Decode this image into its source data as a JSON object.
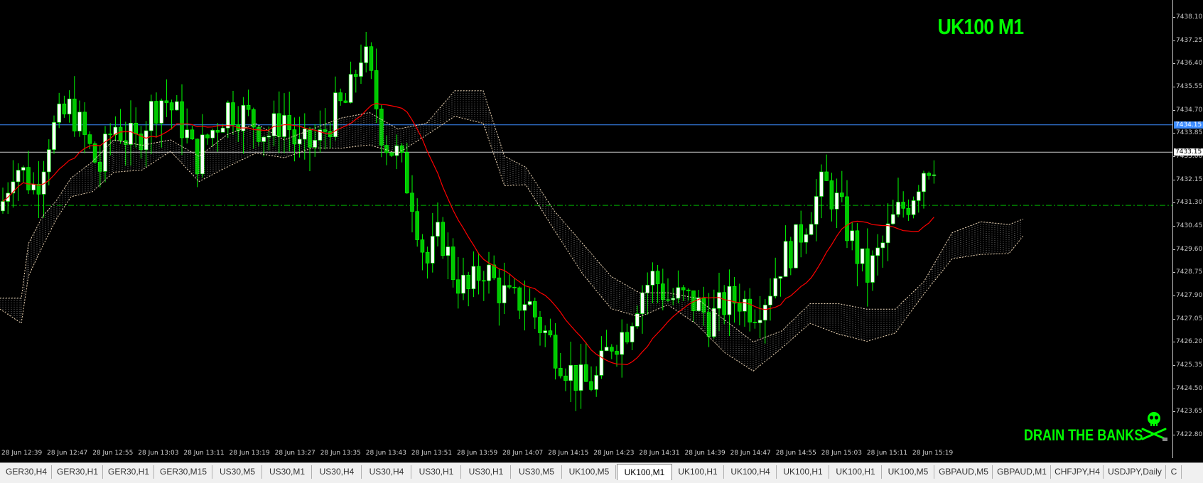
{
  "chart": {
    "symbol_title": "UK100 M1",
    "watermark": "DRAIN THE BANKS",
    "colors": {
      "background": "#000000",
      "bull_candle": "#ffffff",
      "bear_candle": "#00c800",
      "wick": "#00ff00",
      "moving_average": "#ff0000",
      "cloud_edge": "#f0d7b4",
      "bid_line": "#3c8cff",
      "ask_line": "#c8c8c8",
      "level_line": "#00b400",
      "text_green": "#00ff00"
    },
    "icons": {
      "skull": "skull-crossbones-icon"
    }
  },
  "price_axis": {
    "ticks": [
      "7438.10",
      "7437.25",
      "7436.40",
      "7435.55",
      "7434.70",
      "7433.85",
      "7433.00",
      "7432.15",
      "7431.30",
      "7430.45",
      "7429.60",
      "7428.75",
      "7427.90",
      "7427.05",
      "7426.20",
      "7425.35",
      "7424.50",
      "7423.65",
      "7422.80"
    ],
    "bid_tag": "7434.15",
    "ask_tag": "7433.15"
  },
  "time_axis": {
    "labels": [
      "28 Jun 12:39",
      "28 Jun 12:47",
      "28 Jun 12:55",
      "28 Jun 13:03",
      "28 Jun 13:11",
      "28 Jun 13:19",
      "28 Jun 13:27",
      "28 Jun 13:35",
      "28 Jun 13:43",
      "28 Jun 13:51",
      "28 Jun 13:59",
      "28 Jun 14:07",
      "28 Jun 14:15",
      "28 Jun 14:23",
      "28 Jun 14:31",
      "28 Jun 14:39",
      "28 Jun 14:47",
      "28 Jun 14:55",
      "28 Jun 15:03",
      "28 Jun 15:11",
      "28 Jun 15:19"
    ]
  },
  "tabs": [
    {
      "label": "GER30,H4"
    },
    {
      "label": "GER30,H1"
    },
    {
      "label": "GER30,H1"
    },
    {
      "label": "GER30,M15"
    },
    {
      "label": "US30,M5"
    },
    {
      "label": "US30,M1"
    },
    {
      "label": "US30,H4"
    },
    {
      "label": "US30,H4"
    },
    {
      "label": "US30,H1"
    },
    {
      "label": "US30,H1"
    },
    {
      "label": "US30,M5"
    },
    {
      "label": "UK100,M5"
    },
    {
      "label": "UK100,M1",
      "active": true
    },
    {
      "label": "UK100,H1"
    },
    {
      "label": "UK100,H4"
    },
    {
      "label": "UK100,H1"
    },
    {
      "label": "UK100,H1"
    },
    {
      "label": "UK100,M5"
    },
    {
      "label": "GBPAUD,M5"
    },
    {
      "label": "GBPAUD,M1"
    },
    {
      "label": "CHFJPY,H4"
    },
    {
      "label": "USDJPY,Daily"
    },
    {
      "label": "C"
    }
  ]
}
